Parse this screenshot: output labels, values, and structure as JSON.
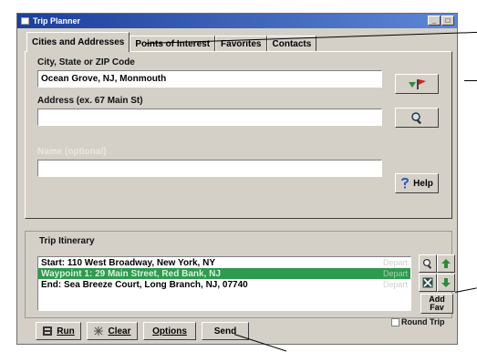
{
  "window": {
    "title": "Trip Planner",
    "controls": [
      "_",
      "□"
    ]
  },
  "tabs": [
    {
      "label": "Cities and Addresses",
      "active": true
    },
    {
      "label": "Points of Interest",
      "active": false
    },
    {
      "label": "Favorites",
      "active": false
    },
    {
      "label": "Contacts",
      "active": false
    }
  ],
  "form": {
    "city_label": "City, State or ZIP Code",
    "city_value": "Ocean Grove, NJ, Monmouth",
    "address_label": "Address (ex. 67 Main St)",
    "address_value": "",
    "third_label": "Name (optional)",
    "third_value": ""
  },
  "side_buttons": {
    "help_label": "Help"
  },
  "itinerary": {
    "title": "Trip Itinerary",
    "rows": [
      {
        "text": "Start: 110 West Broadway, New York, NY",
        "tag": "Depart",
        "selected": false
      },
      {
        "text": "Waypoint 1: 29 Main Street, Red Bank, NJ",
        "tag": "Depart",
        "selected": true
      },
      {
        "text": "End: Sea Breeze Court, Long Branch, NJ, 07740",
        "tag": "Depart",
        "selected": false
      },
      {
        "text": "",
        "tag": "",
        "selected": false
      }
    ],
    "add_label": "Add",
    "fav_label": "Fav",
    "round_trip_label": "Round Trip"
  },
  "bottom": {
    "route_label": "Run",
    "clear_label": "Clear",
    "options_label": "Options",
    "send_label": "Send"
  },
  "colors": {
    "title_bar": "#1c3f9a",
    "selected_row": "#2e9a4e",
    "arrow_green": "#2e8a3a",
    "flag_red": "#d02020"
  }
}
